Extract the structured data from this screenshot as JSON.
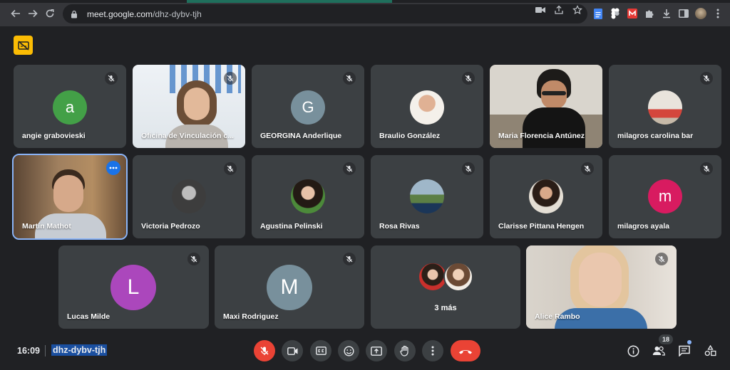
{
  "browser": {
    "url_host": "meet.google.com",
    "url_path": "/dhz-dybv-tjh"
  },
  "colors": {
    "tile_bg": "#3c4043",
    "stage_bg": "#202124",
    "accent_blue": "#8ab4f8",
    "hangup_red": "#ea4335",
    "cc_yellow": "#fbbc04"
  },
  "participants": [
    {
      "name": "angie grabovieski",
      "initial": "a",
      "avatar_color": "#43a047",
      "kind": "initial",
      "muted": true
    },
    {
      "name": "Oficina de Vinculación c...",
      "kind": "video",
      "muted": true
    },
    {
      "name": "GEORGINA Anderlique",
      "initial": "G",
      "avatar_color": "#78909c",
      "kind": "initial",
      "muted": true
    },
    {
      "name": "Braulio González",
      "kind": "photo",
      "muted": true
    },
    {
      "name": "Maria Florencia Antúnez",
      "kind": "video",
      "muted": false
    },
    {
      "name": "milagros carolina bar",
      "kind": "photo",
      "muted": true
    },
    {
      "name": "Martín Mathot",
      "kind": "video",
      "muted": false,
      "active": true
    },
    {
      "name": "Victoria Pedrozo",
      "kind": "photo",
      "muted": true
    },
    {
      "name": "Agustina Pelinski",
      "kind": "photo",
      "muted": true
    },
    {
      "name": "Rosa Rivas",
      "kind": "photo",
      "muted": true
    },
    {
      "name": "Clarisse Pittana Hengen",
      "kind": "photo",
      "muted": true
    },
    {
      "name": "milagros ayala",
      "initial": "m",
      "avatar_color": "#d81b60",
      "kind": "initial",
      "muted": true
    },
    {
      "name": "Lucas Milde",
      "initial": "L",
      "avatar_color": "#ab47bc",
      "kind": "initial",
      "muted": true
    },
    {
      "name": "Maxi Rodriguez",
      "initial": "M",
      "avatar_color": "#78909c",
      "kind": "initial",
      "muted": true
    },
    {
      "name": "3 más",
      "kind": "overflow",
      "muted": false
    },
    {
      "name": "Alice Rambo",
      "kind": "video",
      "muted": true
    }
  ],
  "footer": {
    "time": "16:09",
    "meeting_code": "dhz-dybv-tjh",
    "participant_count": "18"
  },
  "icons": {
    "cc_off": "captions-off-icon",
    "mic_off": "mic-off-icon",
    "camera": "videocam-icon",
    "captions": "closed-caption-icon",
    "emoji": "emoji-icon",
    "present": "present-screen-icon",
    "hand": "raise-hand-icon",
    "more": "more-vert-icon",
    "hangup": "call-end-icon",
    "info": "info-icon",
    "people": "people-icon",
    "chat": "chat-icon",
    "activities": "activities-icon"
  }
}
